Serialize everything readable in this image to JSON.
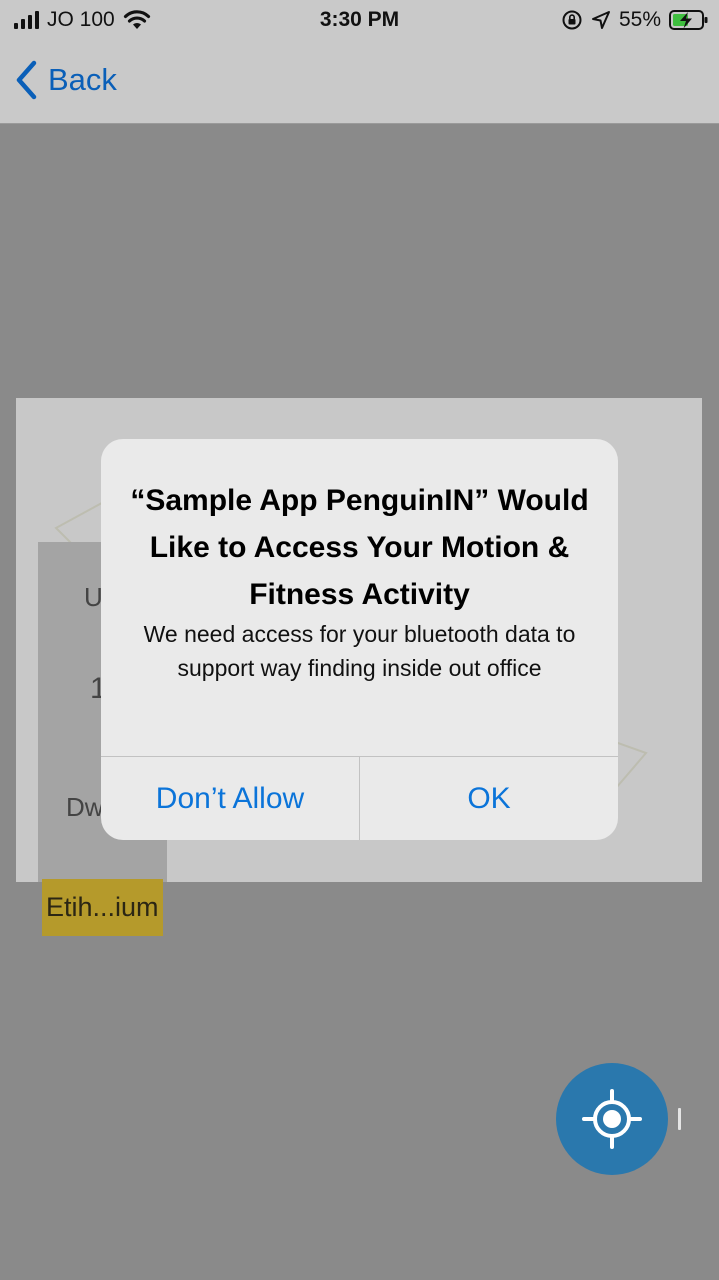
{
  "status_bar": {
    "carrier": "JO 100",
    "time": "3:30 PM",
    "battery_percent": "55%",
    "icons": [
      "signal-icon",
      "wifi-icon",
      "orientation-lock-icon",
      "location-arrow-icon",
      "battery-charging-icon"
    ]
  },
  "nav": {
    "back_label": "Back",
    "back_icon": "chevron-left-icon"
  },
  "map": {
    "building_partial_texts": [
      "U",
      "1",
      "Dw"
    ],
    "place_label": "Etih...ium",
    "locate_icon": "crosshair-icon"
  },
  "alert": {
    "title": "“Sample App PenguinIN” Would Like to Access Your Motion & Fitness Activity",
    "message": "We need access for your bluetooth data to support way finding inside out office",
    "buttons": {
      "deny": "Don’t Allow",
      "ok": "OK"
    }
  },
  "colors": {
    "accent": "#0b74d9",
    "locate_button": "#2a78ad",
    "place_label_bg": "#b59a2b",
    "overlay_gray": "#8a8a8a"
  }
}
